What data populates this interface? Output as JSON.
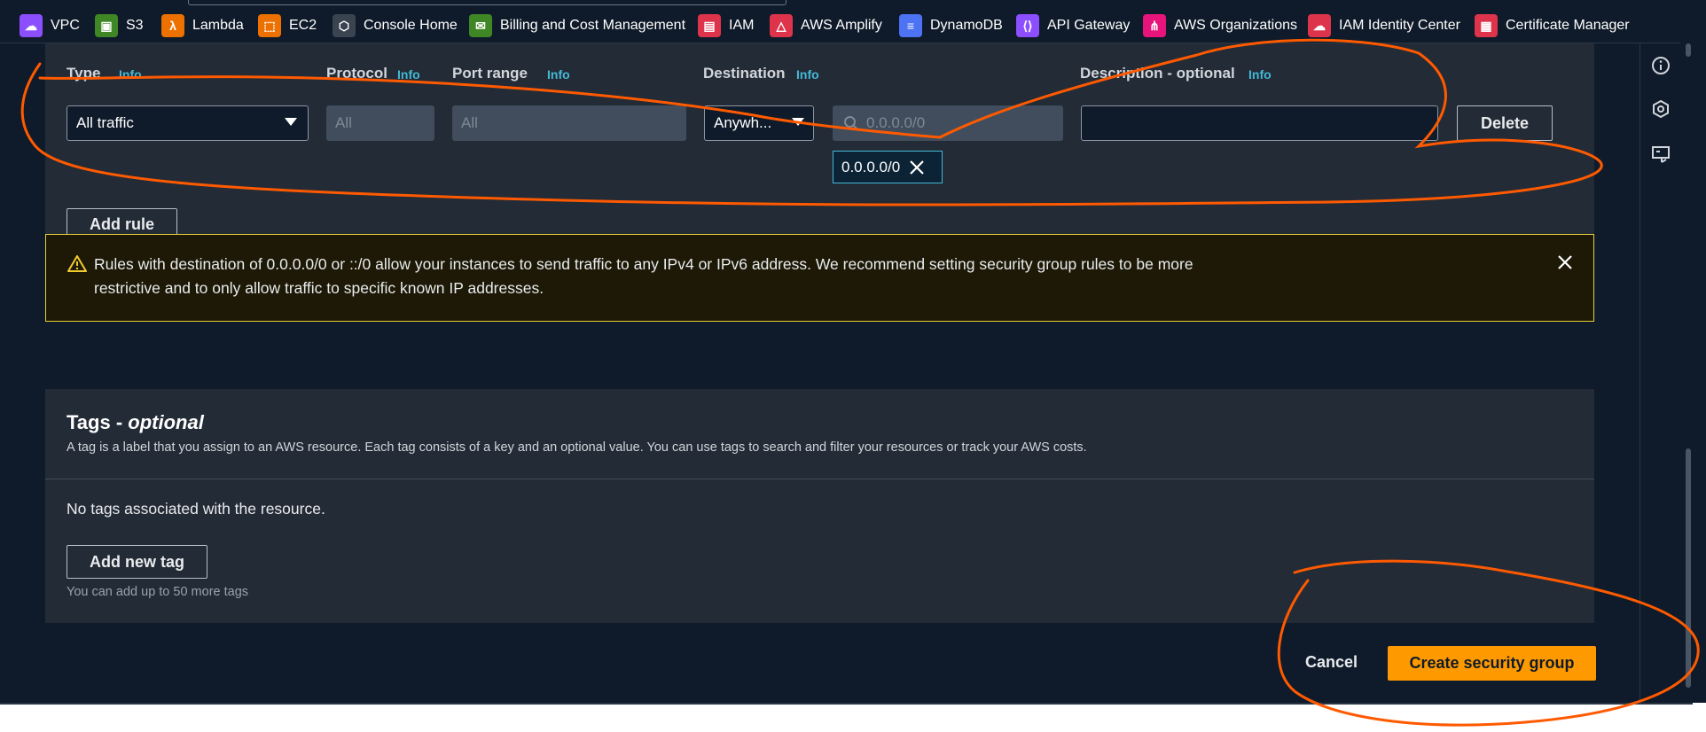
{
  "favorites": [
    {
      "label": "VPC",
      "icon": "cloud-icon",
      "color": "#8c4fff"
    },
    {
      "label": "S3",
      "icon": "bucket-icon",
      "color": "#3f8624"
    },
    {
      "label": "Lambda",
      "icon": "lambda-icon",
      "color": "#ed7100"
    },
    {
      "label": "EC2",
      "icon": "chip-icon",
      "color": "#ed7100"
    },
    {
      "label": "Console Home",
      "icon": "cube-icon",
      "color": "#545b64"
    },
    {
      "label": "Billing and Cost Management",
      "icon": "receipt-icon",
      "color": "#3f8624"
    },
    {
      "label": "IAM",
      "icon": "id-card-icon",
      "color": "#dd344c"
    },
    {
      "label": "AWS Amplify",
      "icon": "amplify-icon",
      "color": "#dd344c"
    },
    {
      "label": "DynamoDB",
      "icon": "database-icon",
      "color": "#4d72f3"
    },
    {
      "label": "API Gateway",
      "icon": "api-icon",
      "color": "#8c4fff"
    },
    {
      "label": "AWS Organizations",
      "icon": "org-icon",
      "color": "#e7157b"
    },
    {
      "label": "IAM Identity Center",
      "icon": "identity-cloud-icon",
      "color": "#dd344c"
    },
    {
      "label": "Certificate Manager",
      "icon": "certificate-icon",
      "color": "#dd344c"
    }
  ],
  "rules": {
    "type_label": "Type",
    "protocol_label": "Protocol",
    "port_range_label": "Port range",
    "destination_label": "Destination",
    "description_label": "Description - optional",
    "info": "Info",
    "type_value": "All traffic",
    "protocol_value": "All",
    "port_range_value": "All",
    "destination_value": "Anywh...",
    "cidr_placeholder": "0.0.0.0/0",
    "description_value": "",
    "token_value": "0.0.0.0/0",
    "delete_label": "Delete",
    "add_rule_label": "Add rule"
  },
  "warning": {
    "text": "Rules with destination of 0.0.0.0/0 or ::/0 allow your instances to send traffic to any IPv4 or IPv6 address. We recommend setting security group rules to be more restrictive and to only allow traffic to specific known IP addresses."
  },
  "tags": {
    "title": "Tags - ",
    "title_optional": "optional",
    "description": "A tag is a label that you assign to an AWS resource. Each tag consists of a key and an optional value. You can use tags to search and filter your resources or track your AWS costs.",
    "empty_text": "No tags associated with the resource.",
    "add_label": "Add new tag",
    "limit_text": "You can add up to 50 more tags"
  },
  "footer": {
    "cancel_label": "Cancel",
    "create_label": "Create security group"
  },
  "colors": {
    "accent_orange": "#ff9900",
    "info_blue": "#44b9d6",
    "annotation_orange": "#ff5a00"
  }
}
